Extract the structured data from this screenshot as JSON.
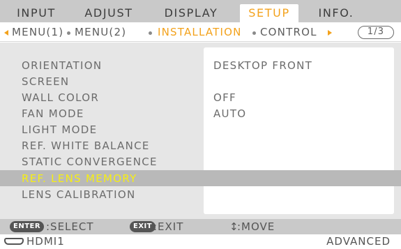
{
  "tabs": [
    "INPUT",
    "ADJUST",
    "DISPLAY",
    "SETUP",
    "INFO."
  ],
  "active_tab": "SETUP",
  "submenu": {
    "items": [
      "MENU(1)",
      "MENU(2)",
      "INSTALLATION",
      "CONTROL"
    ],
    "active": "INSTALLATION",
    "page": "1/3"
  },
  "menu_items": [
    {
      "label": "ORIENTATION",
      "value": "DESKTOP FRONT"
    },
    {
      "label": "SCREEN",
      "value": ""
    },
    {
      "label": "WALL COLOR",
      "value": "OFF"
    },
    {
      "label": "FAN MODE",
      "value": "AUTO"
    },
    {
      "label": "LIGHT MODE",
      "value": ""
    },
    {
      "label": "REF. WHITE BALANCE",
      "value": ""
    },
    {
      "label": "STATIC CONVERGENCE",
      "value": ""
    },
    {
      "label": "REF. LENS MEMORY",
      "value": ""
    },
    {
      "label": "LENS CALIBRATION",
      "value": ""
    }
  ],
  "selected_item": "REF. LENS MEMORY",
  "help": {
    "enter_key": "ENTER",
    "enter_label": ":SELECT",
    "exit_key": "EXIT",
    "exit_label": ":EXIT",
    "move_symbol": "↕",
    "move_label": ":MOVE"
  },
  "status": {
    "source_icon": "hdmi-port-icon",
    "source": "HDMI1",
    "mode": "ADVANCED"
  },
  "colors": {
    "active_accent": "#f3a21c",
    "selected_text": "#f6ee14",
    "selected_row": "#b9b9b9"
  }
}
